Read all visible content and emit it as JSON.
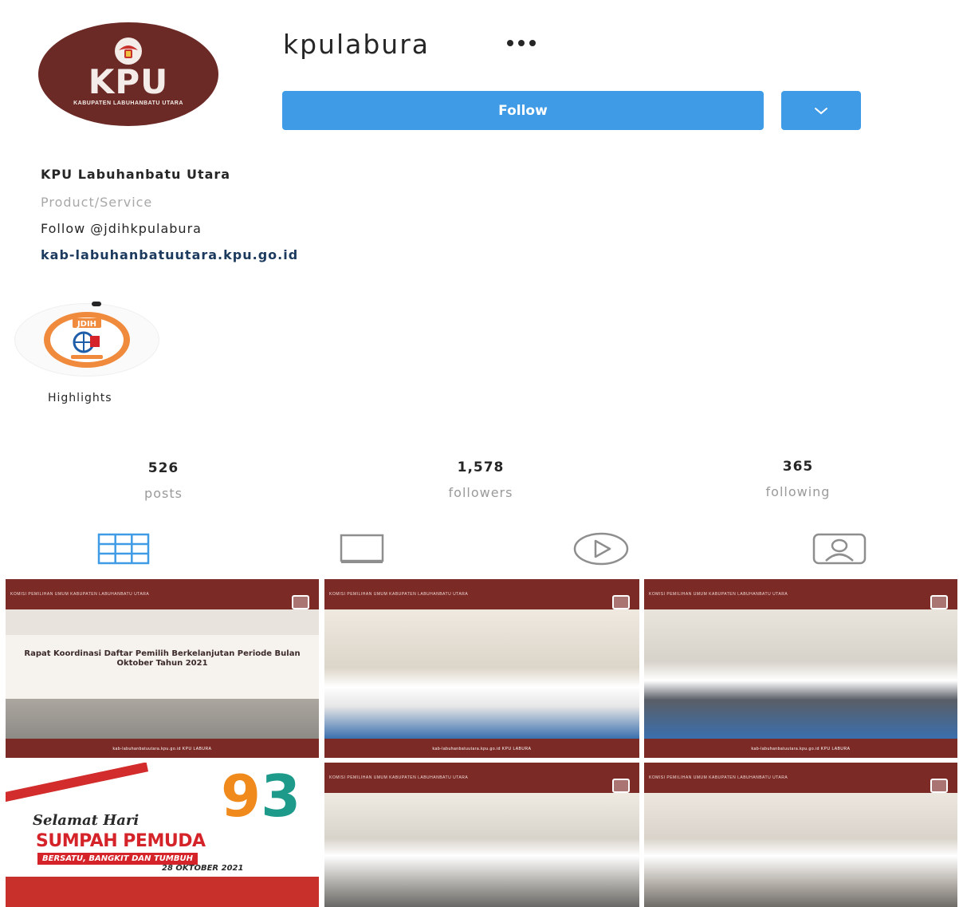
{
  "profile": {
    "username": "kpulabura",
    "avatar_title": "KPU",
    "avatar_subtitle": "KABUPATEN LABUHANBATU UTARA",
    "follow_label": "Follow",
    "name": "KPU Labuhanbatu Utara",
    "category": "Product/Service",
    "bio": "Follow @jdihkpulabura",
    "website": "kab-labuhanbatuutara.kpu.go.id"
  },
  "highlights": [
    {
      "label": "Highlights",
      "badge": "JDIH"
    }
  ],
  "stats": {
    "posts": {
      "value": "526",
      "label": "posts"
    },
    "followers": {
      "value": "1,578",
      "label": "followers"
    },
    "following": {
      "value": "365",
      "label": "following"
    }
  },
  "tabs": [
    {
      "icon": "grid-icon",
      "active": true
    },
    {
      "icon": "feed-icon",
      "active": false
    },
    {
      "icon": "reels-icon",
      "active": false
    },
    {
      "icon": "tagged-icon",
      "active": false
    }
  ],
  "posts": [
    {
      "banner": "KOMISI PEMILIHAN UMUM KABUPATEN LABUHANBATU UTARA",
      "title": "Rapat Koordinasi Daftar Pemilih Berkelanjutan Periode Bulan Oktober Tahun 2021",
      "footer": "kab-labuhanbatuutara.kpu.go.id   KPU LABURA"
    },
    {
      "banner": "KOMISI PEMILIHAN UMUM KABUPATEN LABUHANBATU UTARA",
      "footer": "kab-labuhanbatuutara.kpu.go.id   KPU LABURA"
    },
    {
      "banner": "KOMISI PEMILIHAN UMUM KABUPATEN LABUHANBATU UTARA",
      "footer": "kab-labuhanbatuutara.kpu.go.id   KPU LABURA"
    },
    {
      "script": "Selamat Hari",
      "title": "SUMPAH PEMUDA",
      "subtitle": "BERSATU, BANGKIT DAN TUMBUH",
      "date": "28 OKTOBER 2021",
      "number": "93"
    },
    {
      "banner": "KOMISI PEMILIHAN UMUM KABUPATEN LABUHANBATU UTARA"
    },
    {
      "banner": "KOMISI PEMILIHAN UMUM KABUPATEN LABUHANBATU UTARA"
    }
  ],
  "colors": {
    "follow_button": "#3f9be6",
    "accent_blue": "#3f9be6",
    "kpu_maroon": "#7c2a26",
    "muted_text": "#a8a8a8",
    "link_text": "#1c3a5e"
  }
}
